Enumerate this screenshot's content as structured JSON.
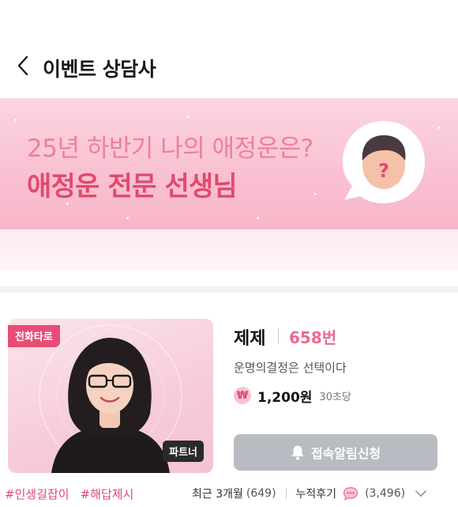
{
  "header": {
    "title": "이벤트 상담사",
    "back_icon": "chevron-left-icon"
  },
  "banner": {
    "headline": "25년 하반기 나의 애정운은?",
    "subline": "애정운 전문 선생님",
    "icon": "question-person-icon",
    "colors": {
      "background": "#f9c2d2",
      "headline": "#ef7f9f",
      "subline": "#e1496f"
    }
  },
  "counselor": {
    "category_tag": "전화타로",
    "partner_tag": "파트너",
    "name": "제제",
    "number": "658번",
    "tagline": "운명의결정은 선택이다",
    "currency_symbol": "₩",
    "price": "1,200원",
    "price_unit": "30초당",
    "notify_button": "접속알림신청",
    "notify_icon": "bell-icon",
    "hashtags": [
      "#인생길잡이",
      "#해답제시"
    ],
    "recent_label": "최근 3개월",
    "recent_count": "(649)",
    "reviews_label": "누적후기",
    "reviews_count": "(3,496)",
    "review_icon": "speech-bubble-icon",
    "expand_icon": "chevron-down-icon",
    "colors": {
      "accent": "#e1496f",
      "number": "#ec6a8e",
      "button": "#b8bcc2"
    }
  }
}
